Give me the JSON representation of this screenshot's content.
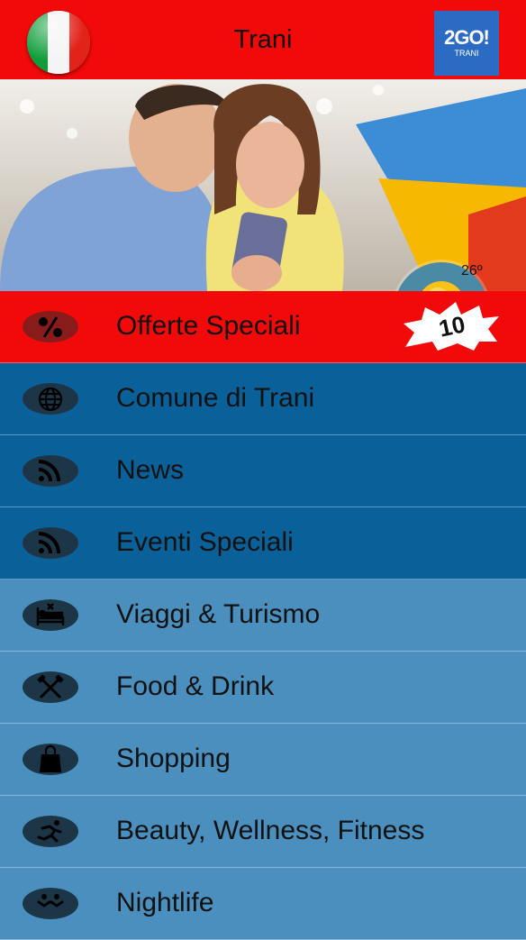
{
  "header": {
    "title": "Trani",
    "logo_main": "2GO!",
    "logo_sub": "TRANI"
  },
  "weather": {
    "temperature": "26º",
    "icon": "sun-cloud-icon"
  },
  "menu": [
    {
      "label": "Offerte Speciali",
      "icon": "percent-icon",
      "badge": "10",
      "style": "red"
    },
    {
      "label": "Comune di Trani",
      "icon": "globe-icon",
      "style": "dark"
    },
    {
      "label": "News",
      "icon": "rss-icon",
      "style": "dark"
    },
    {
      "label": "Eventi Speciali",
      "icon": "rss-icon",
      "style": "dark"
    },
    {
      "label": "Viaggi & Turismo",
      "icon": "bed-icon",
      "style": "light"
    },
    {
      "label": "Food & Drink",
      "icon": "fork-knife-icon",
      "style": "light"
    },
    {
      "label": "Shopping",
      "icon": "shopping-bag-icon",
      "style": "light"
    },
    {
      "label": "Beauty, Wellness, Fitness",
      "icon": "runner-icon",
      "style": "light"
    },
    {
      "label": "Nightlife",
      "icon": "party-icon",
      "style": "light"
    }
  ],
  "colors": {
    "header_red": "#f20a0a",
    "dark_blue": "#0a6199",
    "light_blue": "#4a8fbd"
  }
}
